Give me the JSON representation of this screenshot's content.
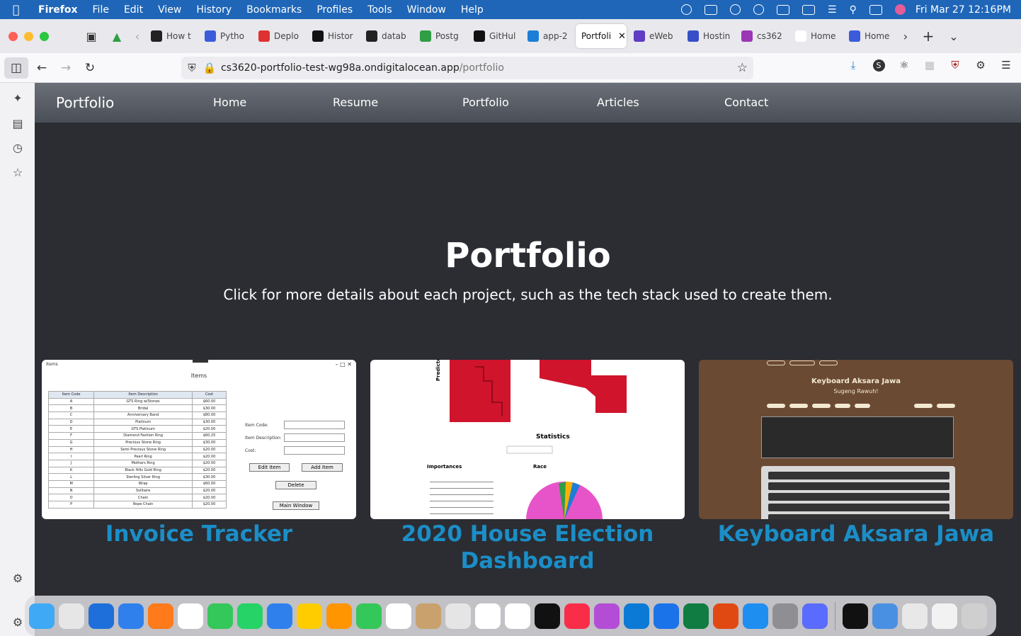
{
  "menubar": {
    "app": "Firefox",
    "items": [
      "File",
      "Edit",
      "View",
      "History",
      "Bookmarks",
      "Profiles",
      "Tools",
      "Window",
      "Help"
    ],
    "datetime": "Fri Mar 27  12:16PM"
  },
  "tabs": [
    {
      "label": "How t",
      "color": "#222222"
    },
    {
      "label": "Pytho",
      "color": "#3b5bdb"
    },
    {
      "label": "Deplo",
      "color": "#e03131"
    },
    {
      "label": "Histor",
      "color": "#111111"
    },
    {
      "label": "datab",
      "color": "#222222"
    },
    {
      "label": "Postg",
      "color": "#2f9e44"
    },
    {
      "label": "GitHul",
      "color": "#111111"
    },
    {
      "label": "app-2",
      "color": "#1c7ed6"
    },
    {
      "label": "Portfoli",
      "color": "#ffffff",
      "active": true
    },
    {
      "label": "eWeb",
      "color": "#5f3dc4"
    },
    {
      "label": "Hostin",
      "color": "#364fc7"
    },
    {
      "label": "cs362",
      "color": "#9c36b5"
    },
    {
      "label": "Home",
      "color": "#ffffff"
    },
    {
      "label": "Home",
      "color": "#3b5bdb"
    }
  ],
  "url": {
    "host": "cs3620-portfolio-test-wg98a.ondigitalocean.app",
    "path": "/portfolio"
  },
  "site": {
    "brand": "Portfolio",
    "nav": [
      "Home",
      "Resume",
      "Portfolio",
      "Articles",
      "Contact"
    ],
    "title": "Portfolio",
    "subtitle": "Click for more details about each project, such as the tech stack used to create them."
  },
  "projects": [
    {
      "title": "Invoice Tracker"
    },
    {
      "title": "2020 House Election Dashboard"
    },
    {
      "title": "Keyboard Aksara Jawa"
    }
  ],
  "invoice_thumb": {
    "window_title": "Items",
    "heading": "Items",
    "headers": [
      "Item Code",
      "Item Description",
      "Cost"
    ],
    "rows": [
      [
        "A",
        "GTS Ring w/Stones",
        "$60.00"
      ],
      [
        "B",
        "Bridal",
        "$30.00"
      ],
      [
        "C",
        "Anniversary Band",
        "$80.00"
      ],
      [
        "D",
        "Platinum",
        "$30.00"
      ],
      [
        "E",
        "GTS Platinum",
        "$20.00"
      ],
      [
        "F",
        "Diamond Fashion Ring",
        "$60.25"
      ],
      [
        "G",
        "Precious Stone Ring",
        "$30.00"
      ],
      [
        "H",
        "Semi Precious Stone Ring",
        "$20.00"
      ],
      [
        "I",
        "Pearl Ring",
        "$20.00"
      ],
      [
        "J",
        "Mothers Ring",
        "$20.00"
      ],
      [
        "K",
        "Black Hills Gold Ring",
        "$20.00"
      ],
      [
        "L",
        "Sterling Silver Ring",
        "$30.00"
      ],
      [
        "M",
        "Wrap",
        "$60.00"
      ],
      [
        "N",
        "Solitaire",
        "$20.00"
      ],
      [
        "O",
        "Chain",
        "$20.00"
      ],
      [
        "P",
        "Rope Chain",
        "$20.00"
      ]
    ],
    "labels": [
      "Item Code:",
      "Item Description:",
      "Cost:"
    ],
    "buttons": [
      "Edit Item",
      "Add Item",
      "Delete",
      "Main Window"
    ]
  },
  "election_thumb": {
    "ylabel": "Predicted",
    "stats": "Statistics",
    "importances": "Importances",
    "race": "Race"
  },
  "kbd_thumb": {
    "title": "Keyboard Aksara Jawa",
    "subtitle": "Sugeng Rawuh!"
  }
}
